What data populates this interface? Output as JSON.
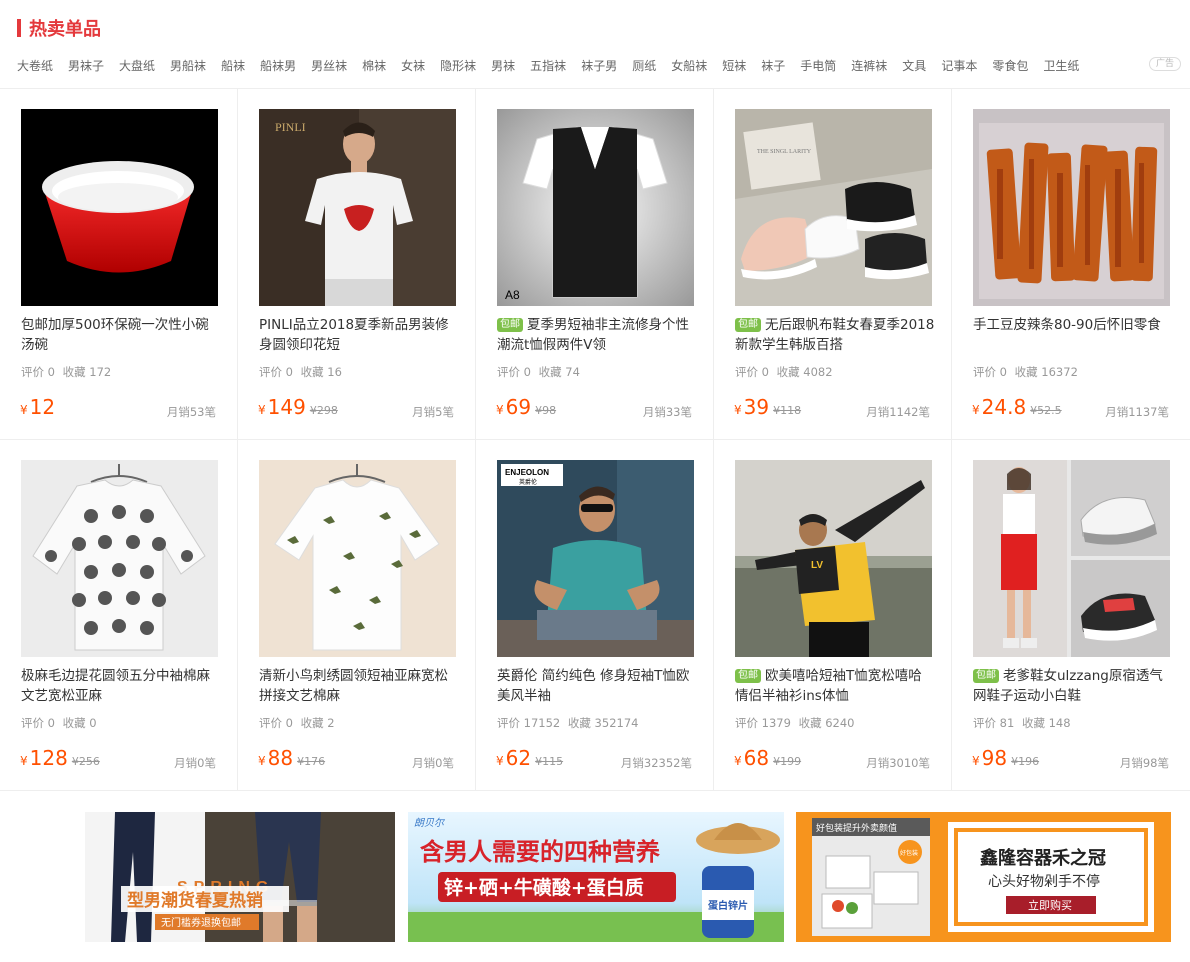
{
  "section_title": "热卖单品",
  "tags": [
    "大卷纸",
    "男袜子",
    "大盘纸",
    "男船袜",
    "船袜",
    "船袜男",
    "男丝袜",
    "棉袜",
    "女袜",
    "隐形袜",
    "男袜",
    "五指袜",
    "袜子男",
    "厕纸",
    "女船袜",
    "短袜",
    "袜子",
    "手电筒",
    "连裤袜",
    "文具",
    "记事本",
    "零食包",
    "卫生纸"
  ],
  "ad_label": "广告",
  "products": [
    {
      "name": "包邮加厚500环保碗一次性小碗汤碗",
      "badge": "",
      "rating": "评价 0",
      "fav": "收藏 172",
      "yen": "¥",
      "price": "12",
      "orig": "",
      "sales": "月销53笔"
    },
    {
      "name": "PINLI品立2018夏季新品男装修身圆领印花短",
      "badge": "",
      "rating": "评价 0",
      "fav": "收藏 16",
      "yen": "¥",
      "price": "149",
      "orig": "¥298",
      "sales": "月销5笔"
    },
    {
      "name": "夏季男短袖非主流修身个性潮流t恤假两件V领",
      "badge": "包邮",
      "rating": "评价 0",
      "fav": "收藏 74",
      "yen": "¥",
      "price": "69",
      "orig": "¥98",
      "sales": "月销33笔"
    },
    {
      "name": "无后跟帆布鞋女春夏季2018新款学生韩版百搭",
      "badge": "包邮",
      "rating": "评价 0",
      "fav": "收藏 4082",
      "yen": "¥",
      "price": "39",
      "orig": "¥118",
      "sales": "月销1142笔"
    },
    {
      "name": "手工豆皮辣条80-90后怀旧零食",
      "badge": "",
      "rating": "评价 0",
      "fav": "收藏 16372",
      "yen": "¥",
      "price": "24.8",
      "orig": "¥52.5",
      "sales": "月销1137笔"
    },
    {
      "name": "极麻毛边提花圆领五分中袖棉麻文艺宽松亚麻",
      "badge": "",
      "rating": "评价 0",
      "fav": "收藏 0",
      "yen": "¥",
      "price": "128",
      "orig": "¥256",
      "sales": "月销0笔"
    },
    {
      "name": "清新小鸟刺绣圆领短袖亚麻宽松拼接文艺棉麻",
      "badge": "",
      "rating": "评价 0",
      "fav": "收藏 2",
      "yen": "¥",
      "price": "88",
      "orig": "¥176",
      "sales": "月销0笔"
    },
    {
      "name": "英爵伦 简约纯色 修身短袖T恤欧美风半袖",
      "badge": "",
      "rating": "评价 17152",
      "fav": "收藏 352174",
      "yen": "¥",
      "price": "62",
      "orig": "¥115",
      "sales": "月销32352笔"
    },
    {
      "name": "欧美嘻哈短袖T恤宽松嘻哈情侣半袖衫ins体恤",
      "badge": "包邮",
      "rating": "评价 1379",
      "fav": "收藏 6240",
      "yen": "¥",
      "price": "68",
      "orig": "¥199",
      "sales": "月销3010笔"
    },
    {
      "name": "老爹鞋女ulzzang原宿透气网鞋子运动小白鞋",
      "badge": "包邮",
      "rating": "评价 81",
      "fav": "收藏 148",
      "yen": "¥",
      "price": "98",
      "orig": "¥196",
      "sales": "月销98笔"
    }
  ],
  "image_texts": {
    "pinli_logo": "PINLI",
    "a8": "A8",
    "box_text": "THE SINGL LARITY",
    "enjeolon": "ENJEOLON",
    "enjeolon_cn": "英爵伦",
    "lv": "LV"
  },
  "banners": {
    "b1": {
      "spring": "SPRING",
      "main": "型男潮货春夏热销",
      "sub": "无门槛券退换包邮"
    },
    "b2": {
      "brand": "朗贝尔",
      "headline": "含男人需要的四种营养",
      "nutrients": "锌+硒+牛磺酸+蛋白质",
      "bottle": "蛋白锌片"
    },
    "b3": {
      "top": "好包装提升外卖颜值",
      "title": "鑫隆容器禾之冠",
      "sub": "心头好物剁手不停",
      "cta": "立即购买",
      "sticker": "好包装"
    }
  }
}
